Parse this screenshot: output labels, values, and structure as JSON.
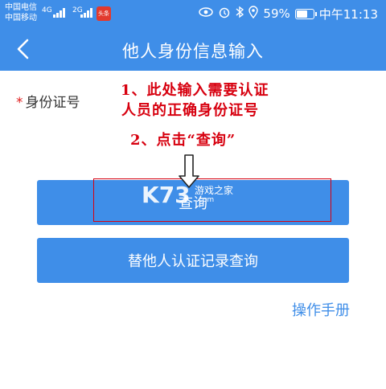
{
  "status_bar": {
    "carrier_1": "中国电信",
    "carrier_2": "中国移动",
    "net_1": "4G",
    "net_2": "2G",
    "news_badge": "头条",
    "battery": "59%",
    "time": "中午11:13",
    "icons": [
      "eye-icon",
      "alarm-icon",
      "bluetooth-icon",
      "location-icon",
      "battery-icon"
    ]
  },
  "header": {
    "back_icon": "chevron-left-icon",
    "title": "他人身份信息输入"
  },
  "form": {
    "id_label_star": "*",
    "id_label": "身份证号",
    "id_value": ""
  },
  "annotations": {
    "line_1": "1、此处输入需要认证",
    "line_2": "人员的正确身份证号",
    "line_3": "2、点击“查询”"
  },
  "buttons": {
    "query": "查询",
    "history": "替他人认证记录查询"
  },
  "watermark": {
    "logo": "K73",
    "text": "游戏之家",
    "sub": ".com"
  },
  "footer": {
    "manual_link": "操作手册"
  },
  "colors": {
    "brand": "#3f8ee8",
    "annotation": "#d7000f"
  }
}
